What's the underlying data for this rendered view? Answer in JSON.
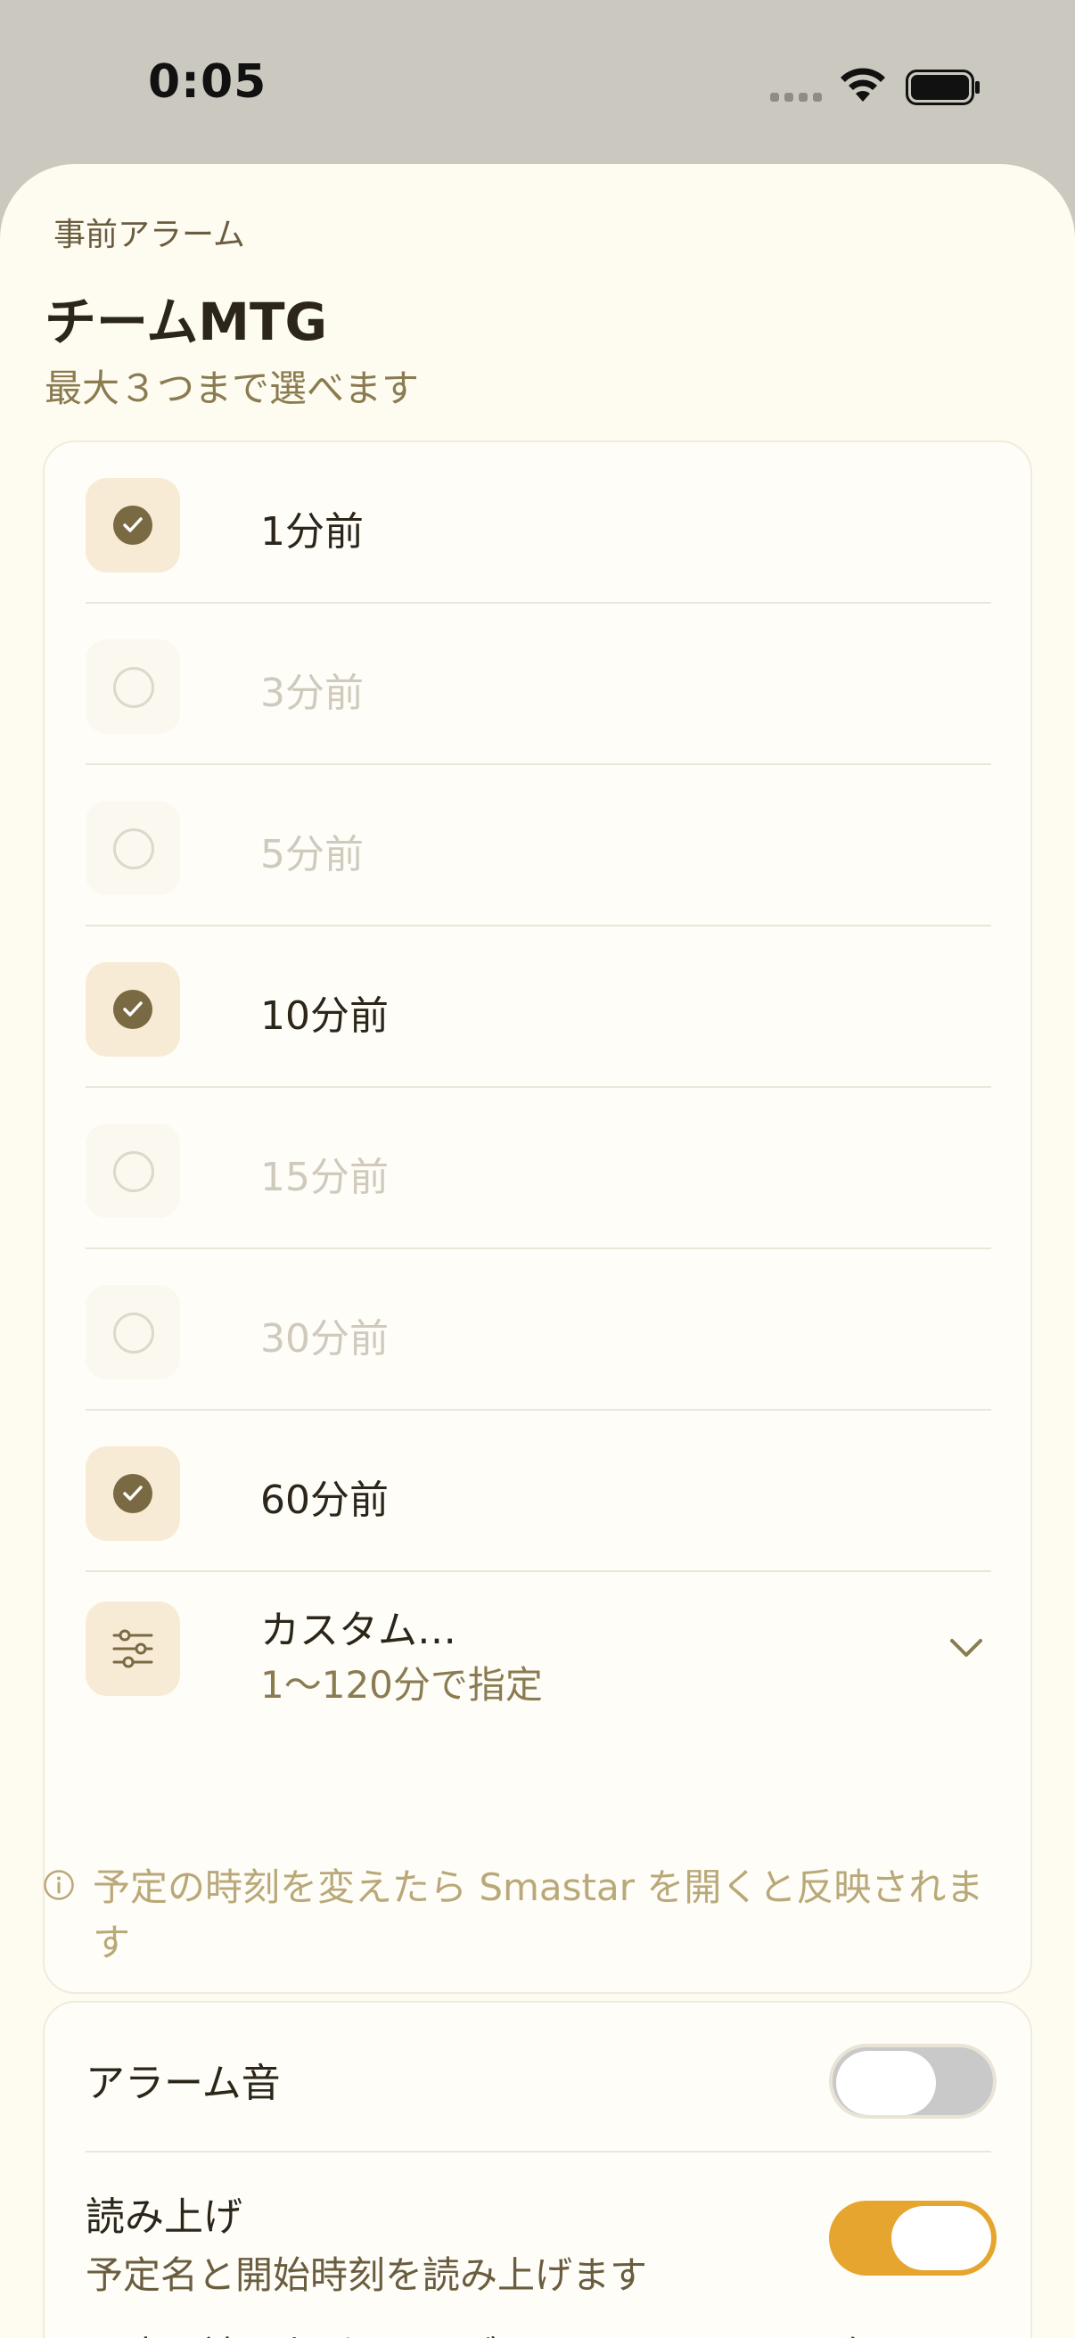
{
  "status_bar": {
    "time": "0:05"
  },
  "header": {
    "eyebrow": "事前アラーム",
    "title": "チームMTG",
    "subtitle": "最大３つまで選べます"
  },
  "options": [
    {
      "label": "1分前",
      "checked": true
    },
    {
      "label": "3分前",
      "checked": false
    },
    {
      "label": "5分前",
      "checked": false
    },
    {
      "label": "10分前",
      "checked": true
    },
    {
      "label": "15分前",
      "checked": false
    },
    {
      "label": "30分前",
      "checked": false
    },
    {
      "label": "60分前",
      "checked": true
    }
  ],
  "custom": {
    "title": "カスタム…",
    "subtitle": "1〜120分で指定"
  },
  "info": {
    "text": "予定の時刻を変えたら Smastar を開くと反映されます"
  },
  "settings": {
    "alarm_sound": {
      "label": "アラーム音",
      "enabled": false
    },
    "read_aloud": {
      "label": "読み上げ",
      "sub": "予定名と開始時刻を読み上げます",
      "enabled": true
    },
    "cut_off_text": "↗ 声は読み上げます。ブザイドセージ ……通知"
  },
  "colors": {
    "accent": "#e6a52e",
    "check": "#7a6a43",
    "background": "#fefbf0"
  }
}
